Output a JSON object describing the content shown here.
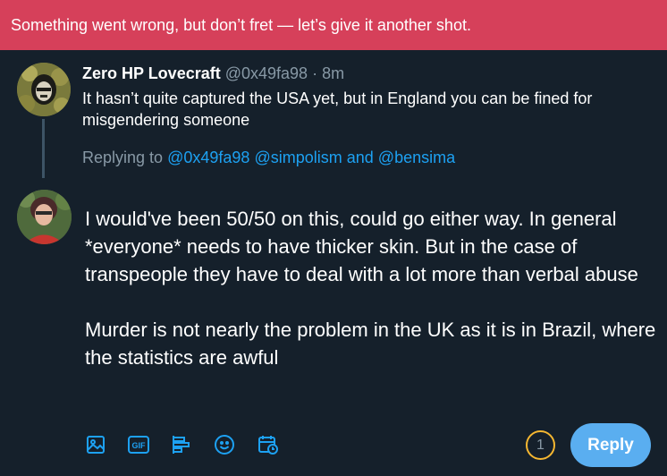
{
  "error_banner": {
    "text": "Something went wrong, but don’t fret — let’s give it another shot."
  },
  "parent_tweet": {
    "display_name": "Zero HP Lovecraft",
    "handle": "@0x49fa98",
    "separator": "·",
    "time": "8m",
    "text": "It hasn’t quite captured the USA yet, but in England you can be fined for misgendering someone"
  },
  "replying_to": {
    "prefix": "Replying to",
    "mentions": [
      "@0x49fa98",
      "@simpolism"
    ],
    "conjunction": "and",
    "last_mention": "@bensima"
  },
  "composer": {
    "paragraphs": [
      "I would've been 50/50 on this, could go either way. In general *everyone* needs to have thicker skin. But in the case of transpeople they have to deal with a lot more than verbal abuse",
      "Murder is not nearly the problem in the UK as it is in Brazil, where the statistics are awful"
    ],
    "counter": "1",
    "reply_label": "Reply"
  },
  "toolbar": {
    "icons": [
      "image-icon",
      "gif-icon",
      "poll-icon",
      "emoji-icon",
      "schedule-icon"
    ],
    "gif_label": "GIF"
  },
  "colors": {
    "background": "#15202b",
    "banner": "#d6405a",
    "accent": "#1da1f2",
    "reply_button": "#5aaef0",
    "counter_ring": "#f5b731",
    "muted_text": "#8899a6"
  }
}
